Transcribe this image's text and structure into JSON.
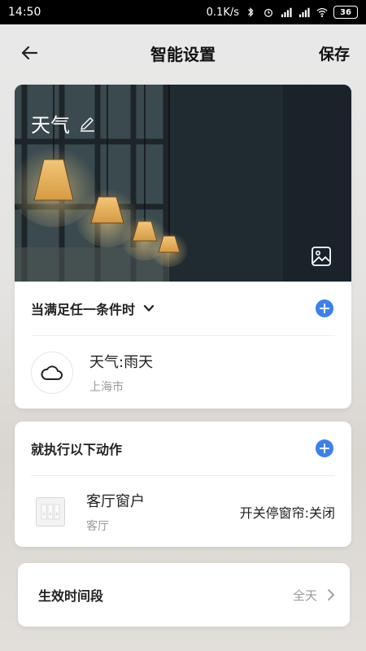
{
  "status_bar": {
    "time": "14:50",
    "network_speed": "0.1K/s",
    "battery": "36",
    "icons": [
      "bluetooth-icon",
      "alarm-icon",
      "signal-icon",
      "hd-signal-icon",
      "wifi-icon",
      "battery-icon"
    ]
  },
  "header": {
    "title": "智能设置",
    "save_label": "保存"
  },
  "scene": {
    "name": "天气",
    "icons": [
      "edit-icon",
      "image-icon"
    ]
  },
  "conditions": {
    "heading": "当满足任一条件时",
    "items": [
      {
        "title": "天气:雨天",
        "subtitle": "上海市",
        "icon": "cloud-icon"
      }
    ]
  },
  "actions": {
    "heading": "就执行以下动作",
    "items": [
      {
        "device": "客厅窗户",
        "room": "客厅",
        "action": "开关停窗帘:关闭",
        "icon": "curtain-switch-icon"
      }
    ]
  },
  "period": {
    "label": "生效时间段",
    "value": "全天"
  },
  "colors": {
    "accent": "#3b82e8",
    "status_bar": "#000000"
  }
}
